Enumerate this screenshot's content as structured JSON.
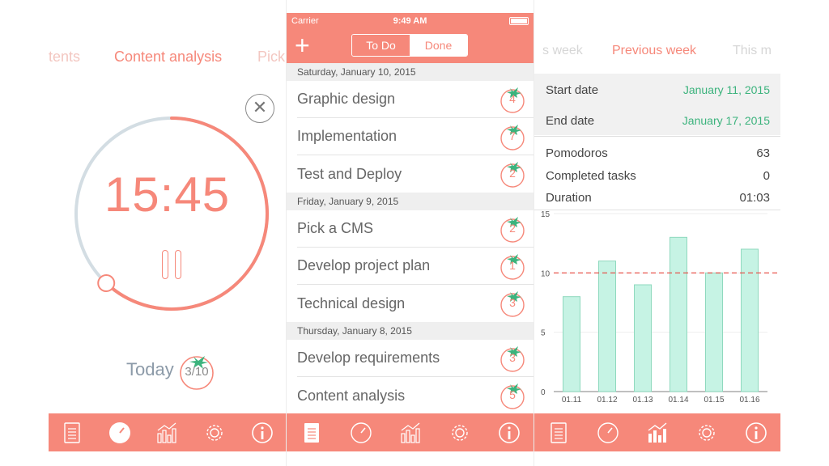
{
  "timer_screen": {
    "categories": [
      {
        "label": "tents",
        "state": "faded"
      },
      {
        "label": "Content analysis",
        "state": "active"
      },
      {
        "label": "Pick",
        "state": "faded"
      }
    ],
    "time": "15:45",
    "today_label": "Today",
    "today_count": "3/10",
    "progress_fraction": 0.62
  },
  "list_screen": {
    "status": {
      "carrier": "Carrier",
      "time": "9:49 AM"
    },
    "segments": {
      "todo": "To Do",
      "done": "Done"
    },
    "sections": [
      {
        "date": "Saturday, January 10, 2015",
        "tasks": [
          {
            "name": "Graphic design",
            "count": "4"
          },
          {
            "name": "Implementation",
            "count": "7"
          },
          {
            "name": "Test and Deploy",
            "count": "2"
          }
        ]
      },
      {
        "date": "Friday, January 9, 2015",
        "tasks": [
          {
            "name": "Pick a CMS",
            "count": "2"
          },
          {
            "name": "Develop project plan",
            "count": "1"
          },
          {
            "name": "Technical design",
            "count": "3"
          }
        ]
      },
      {
        "date": "Thursday, January 8, 2015",
        "tasks": [
          {
            "name": "Develop requirements",
            "count": "3"
          },
          {
            "name": "Content analysis",
            "count": "5"
          }
        ]
      }
    ]
  },
  "stats_screen": {
    "weeks": [
      {
        "label": "s week",
        "state": "faded"
      },
      {
        "label": "Previous week",
        "state": "active"
      },
      {
        "label": "This m",
        "state": "faded"
      }
    ],
    "start_date_label": "Start date",
    "start_date_value": "January 11, 2015",
    "end_date_label": "End date",
    "end_date_value": "January 17, 2015",
    "pomodoros_label": "Pomodoros",
    "pomodoros_value": "63",
    "completed_label": "Completed tasks",
    "completed_value": "0",
    "duration_label": "Duration",
    "duration_value": "01:03"
  },
  "chart_data": {
    "type": "bar",
    "categories": [
      "01.11",
      "01.12",
      "01.13",
      "01.14",
      "01.15",
      "01.16"
    ],
    "values": [
      8,
      11,
      9,
      13,
      10,
      12
    ],
    "ylim": [
      0,
      15
    ],
    "yticks": [
      "0",
      "5",
      "10",
      "15"
    ],
    "target_line": 10,
    "bar_color": "#c6f3e4",
    "bar_border": "#8fd9be",
    "target_color": "#e8453c",
    "grid": true
  },
  "tab_icons": [
    "list-icon",
    "timer-icon",
    "stats-icon",
    "settings-icon",
    "info-icon"
  ],
  "colors": {
    "accent": "#f6887a",
    "green": "#3cb37d",
    "ring_track": "#d3dde3"
  }
}
